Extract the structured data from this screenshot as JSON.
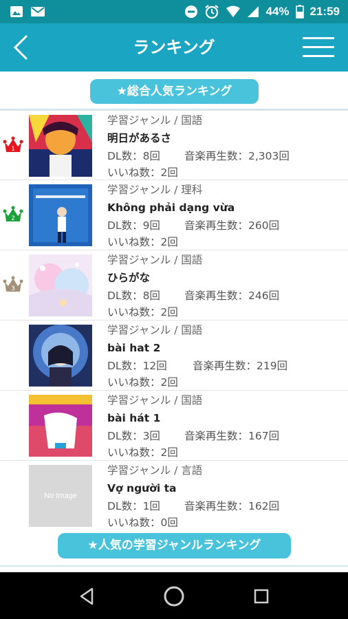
{
  "status_bar": {
    "battery": "44%",
    "time": "21:59",
    "left_icons": [
      "image-icon",
      "mail-icon"
    ],
    "right_icons": [
      "dnd-icon",
      "alarm-icon",
      "wifi-icon",
      "signal-icon",
      "battery-icon"
    ]
  },
  "header": {
    "title": "ランキング",
    "back_icon": "chevron-left-icon",
    "menu_icon": "hamburger-menu-icon"
  },
  "sections": {
    "overall": "★総合人気ランキング",
    "genre": "★人気の学習ジャンルランキング"
  },
  "ranking": [
    {
      "rank": "1",
      "genre": "学習ジャンル / 国語",
      "title": "明日があるさ",
      "dl": "DL数：8回",
      "plays": "音楽再生数：2,303回",
      "likes": "いいね数：2回",
      "crown_color": "#e8141e",
      "thumb": "colorful-illustration"
    },
    {
      "rank": "2",
      "genre": "学習ジャンル / 理科",
      "title": "Không phải dạng vừa",
      "dl": "DL数：9回",
      "plays": "音楽再生数：260回",
      "likes": "いいね数：2回",
      "crown_color": "#1ca23a",
      "thumb": "blue-illustration"
    },
    {
      "rank": "3",
      "genre": "学習ジャンル / 国語",
      "title": "ひらがな",
      "dl": "DL数：8回",
      "plays": "音楽再生数：246回",
      "likes": "いいね数：2回",
      "crown_color": "#a5907a",
      "thumb": "pastel-illustration"
    },
    {
      "rank": "",
      "genre": "学習ジャンル / 国語",
      "title": "bài hat 2",
      "dl": "DL数：12回",
      "plays": "音楽再生数：219回",
      "likes": "いいね数：2回",
      "crown_color": "",
      "thumb": "space-illustration"
    },
    {
      "rank": "",
      "genre": "学習ジャンル / 国語",
      "title": "bài hát 1",
      "dl": "DL数：3回",
      "plays": "音楽再生数：167回",
      "likes": "いいね数：2回",
      "crown_color": "",
      "thumb": "magenta-illustration"
    },
    {
      "rank": "",
      "genre": "学習ジャンル / 言語",
      "title": "Vợ người ta",
      "dl": "DL数：1回",
      "plays": "音楽再生数：162回",
      "likes": "いいね数：0回",
      "crown_color": "",
      "thumb": "no-image",
      "thumb_label": "No Image"
    }
  ],
  "nav_bar": {
    "back": "triangle-back-icon",
    "home": "circle-home-icon",
    "recents": "square-recents-icon"
  }
}
